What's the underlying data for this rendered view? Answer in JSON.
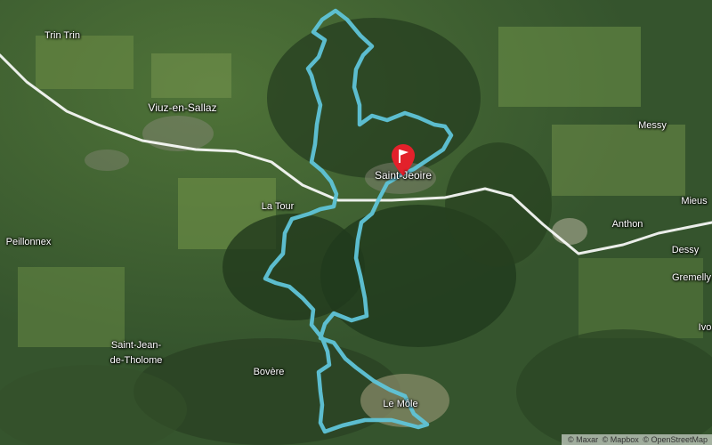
{
  "map": {
    "places": [
      {
        "key": "trin-trin",
        "name": "Trin Trin"
      },
      {
        "key": "viuz-en-sallaz",
        "name": "Viuz-en-Sallaz"
      },
      {
        "key": "messy",
        "name": "Messy"
      },
      {
        "key": "saint-jeoire",
        "name": "Saint-Jeoire"
      },
      {
        "key": "mieussy",
        "name": "Mieus"
      },
      {
        "key": "la-tour",
        "name": "La Tour"
      },
      {
        "key": "peillonnex",
        "name": "Peillonnex"
      },
      {
        "key": "anthon",
        "name": "Anthon"
      },
      {
        "key": "dessy",
        "name": "Dessy"
      },
      {
        "key": "gremelly",
        "name": "Gremelly"
      },
      {
        "key": "ivo",
        "name": "Ivo"
      },
      {
        "key": "saint-jean-1",
        "name": "Saint-Jean-"
      },
      {
        "key": "saint-jean-2",
        "name": "de-Tholome"
      },
      {
        "key": "bovere",
        "name": "Bovère"
      },
      {
        "key": "le-mole",
        "name": "Le Môle"
      }
    ],
    "attribution": [
      "© Maxar",
      "© Mapbox",
      "© OpenStreetMap"
    ],
    "colors": {
      "route": "#5fc4d8",
      "road": "#ffffff",
      "marker": "#e3212b"
    },
    "icons": {
      "start_marker": "flag-marker-icon"
    }
  }
}
